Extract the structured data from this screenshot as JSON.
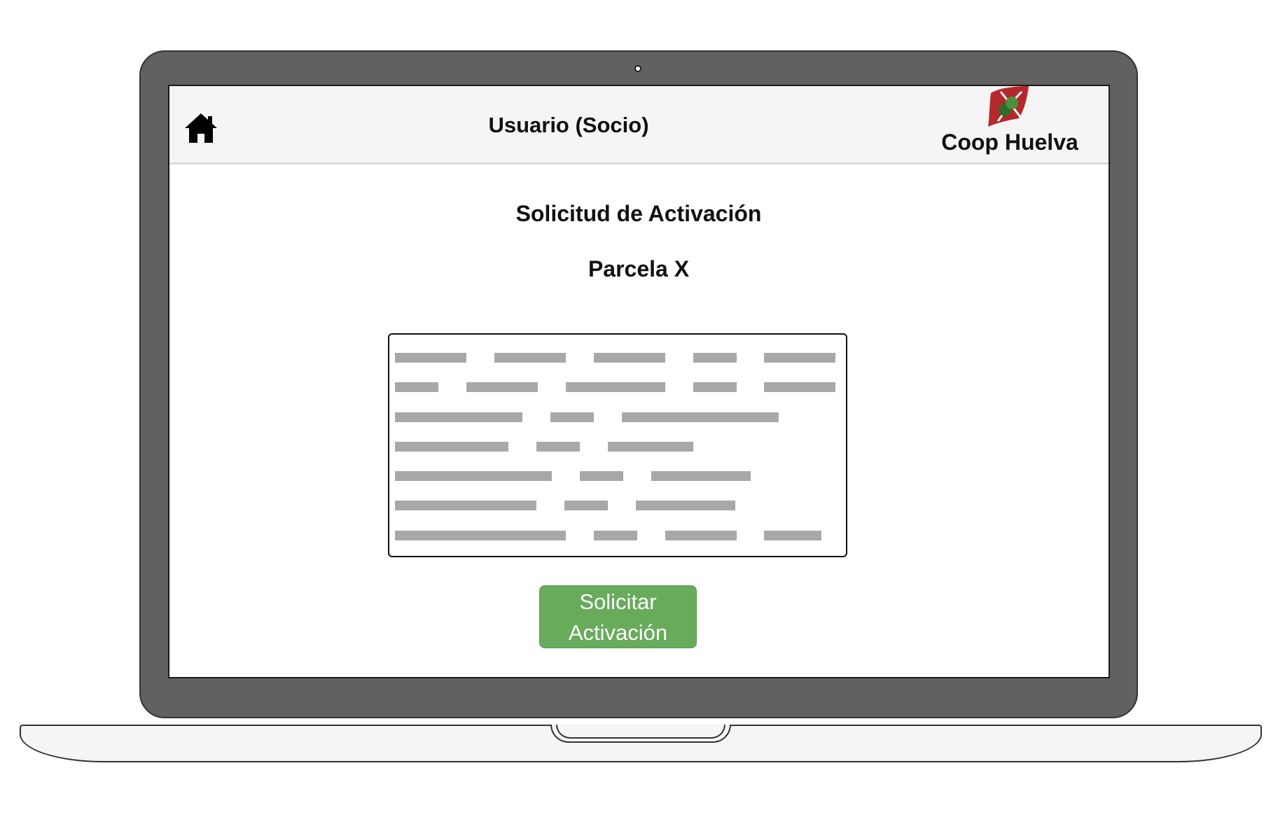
{
  "header": {
    "title": "Usuario (Socio)",
    "home_icon": "home-icon",
    "brand": {
      "name": "Coop Huelva",
      "logo_icon": "coop-huelva-logo",
      "logo_colors": [
        "#b5282b",
        "#3d7a34"
      ]
    }
  },
  "main": {
    "title": "Solicitud de Activación",
    "parcel_title": "Parcela X",
    "content_placeholder": "text-placeholder-lines",
    "action_button": {
      "line1": "Solicitar",
      "line2": "Activación"
    }
  },
  "colors": {
    "bezel": "#616161",
    "header_bg": "#f5f5f5",
    "button_bg": "#67ab5b",
    "placeholder_line": "#a8a8a8"
  }
}
